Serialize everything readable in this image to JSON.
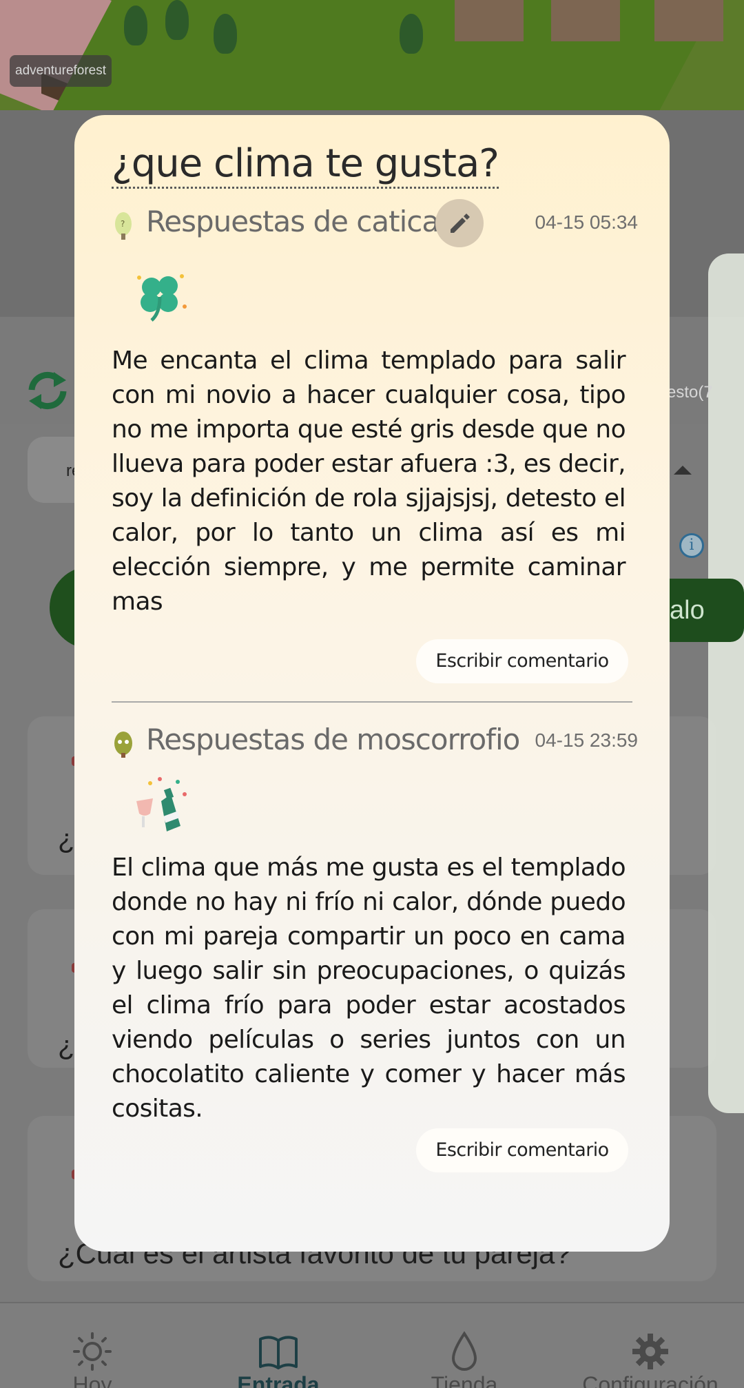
{
  "scene": {
    "place_tag": "adventureforest"
  },
  "background": {
    "pill_label": "re",
    "right_tag": "esto(7",
    "right_button_label": "alo",
    "question_prefix_1": "¿",
    "question_prefix_2": "¿",
    "last_question": "¿Cuál es el artista favorito de tu pareja?"
  },
  "modal": {
    "title": "¿que clima te gusta?",
    "answers": [
      {
        "author_label": "Respuestas de catica",
        "time": "04-15 05:34",
        "sticker": "four-leaf-clover",
        "text": "Me encanta el clima templado para salir con mi novio a hacer cualquier cosa, tipo no me importa que esté gris desde que no llueva para poder estar afuera :3, es decir, soy la definición de rola sjjajsjsj, detesto el calor, por lo tanto un clima así es mi elección siempre, y me permite caminar mas",
        "comment_button": "Escribir comentario"
      },
      {
        "author_label": "Respuestas de moscorrofio",
        "time": "04-15 23:59",
        "sticker": "champagne-toast",
        "text": "El clima que más me gusta es el templado donde no hay ni frío ni calor, dónde puedo con mi pareja compartir un poco en cama y luego salir sin preocupaciones, o quizás el clima frío para poder estar acostados viendo películas o series juntos con un chocolatito caliente y comer y hacer más cositas.",
        "comment_button": "Escribir comentario"
      }
    ]
  },
  "nav": {
    "items": [
      {
        "label": "Hoy",
        "icon": "sun-icon"
      },
      {
        "label": "Entrada",
        "icon": "book-icon"
      },
      {
        "label": "Tienda",
        "icon": "drop-icon"
      },
      {
        "label": "Configuración",
        "icon": "gear-icon"
      }
    ],
    "active": "Entrada"
  },
  "colors": {
    "accent": "#1d3f45",
    "modal_bg_top": "#fff1cf",
    "modal_bg_bottom": "#f5f5f5",
    "overlay": "#7a7a7a"
  }
}
